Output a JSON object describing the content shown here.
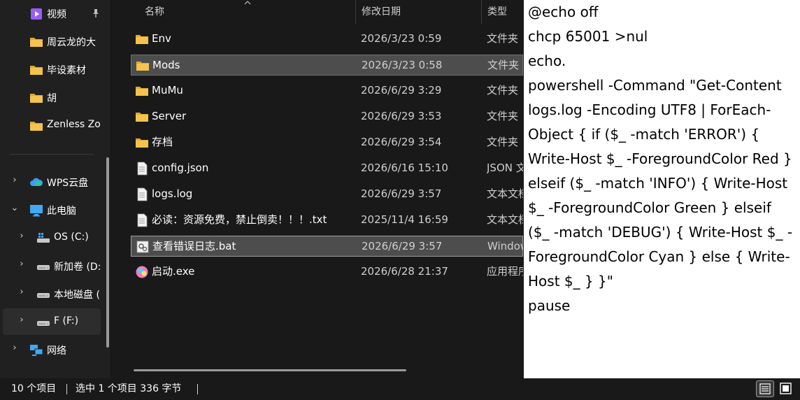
{
  "nav": {
    "quick_access": [
      {
        "label": "视频",
        "icon": "video-icon",
        "pinned": true
      },
      {
        "label": "周云龙的大",
        "icon": "folder-icon"
      },
      {
        "label": "毕设素材",
        "icon": "folder-icon"
      },
      {
        "label": "胡",
        "icon": "folder-icon"
      },
      {
        "label": "Zenless Zo",
        "icon": "folder-icon"
      }
    ],
    "tree": [
      {
        "label": "WPS云盘",
        "icon": "cloud-icon",
        "chevron": "›",
        "expanded": false
      },
      {
        "label": "此电脑",
        "icon": "monitor-icon",
        "chevron": "⌄",
        "expanded": true
      },
      {
        "label": "OS (C:)",
        "icon": "windows-drive-icon",
        "chevron": "›"
      },
      {
        "label": "新加卷 (D:",
        "icon": "drive-icon",
        "chevron": "›"
      },
      {
        "label": "本地磁盘 (",
        "icon": "drive-icon",
        "chevron": "›"
      },
      {
        "label": "F (F:)",
        "icon": "drive-icon",
        "chevron": "›",
        "selected": true
      },
      {
        "label": "网络",
        "icon": "network-icon",
        "chevron": "›"
      }
    ]
  },
  "columns": {
    "name": "名称",
    "date": "修改日期",
    "type": "类型"
  },
  "files": [
    {
      "name": "Env",
      "date": "2026/3/23 0:59",
      "type": "文件夹",
      "icon": "folder-icon"
    },
    {
      "name": "Mods",
      "date": "2026/3/23 0:58",
      "type": "文件夹",
      "icon": "folder-icon",
      "state": "hover"
    },
    {
      "name": "MuMu",
      "date": "2026/6/29 3:29",
      "type": "文件夹",
      "icon": "folder-icon"
    },
    {
      "name": "Server",
      "date": "2026/6/29 3:53",
      "type": "文件夹",
      "icon": "folder-icon"
    },
    {
      "name": "存档",
      "date": "2026/6/29 3:54",
      "type": "文件夹",
      "icon": "folder-icon"
    },
    {
      "name": "config.json",
      "date": "2026/6/16 15:10",
      "type": "JSON 文件",
      "icon": "document-icon"
    },
    {
      "name": "logs.log",
      "date": "2026/6/29 3:57",
      "type": "文本文档",
      "icon": "document-icon"
    },
    {
      "name": "必读：资源免费，禁止倒卖！！！.txt",
      "date": "2025/11/4 16:59",
      "type": "文本文档",
      "icon": "document-icon"
    },
    {
      "name": "查看错误日志.bat",
      "date": "2026/6/29 3:57",
      "type": "Windows 批处理文件",
      "icon": "batch-file-icon",
      "state": "selected"
    },
    {
      "name": "启动.exe",
      "date": "2026/6/28 21:37",
      "type": "应用程序",
      "icon": "app-icon"
    }
  ],
  "preview": {
    "content": "@echo off\nchcp 65001 >nul\necho.\npowershell -Command \"Get-Content logs.log -Encoding UTF8 | ForEach-Object { if ($_ -match 'ERROR') { Write-Host $_ -ForegroundColor Red } elseif ($_ -match 'INFO') { Write-Host $_ -ForegroundColor Green } elseif ($_ -match 'DEBUG') { Write-Host $_ -ForegroundColor Cyan } else { Write-Host $_ } }\"\npause"
  },
  "status": {
    "item_count": "10 个项目",
    "selection": "选中 1 个项目  336 字节"
  },
  "colors": {
    "folder": "#f4c34d",
    "background": "#191919",
    "nav_background": "#202020",
    "selection": "#4d4d4d"
  }
}
